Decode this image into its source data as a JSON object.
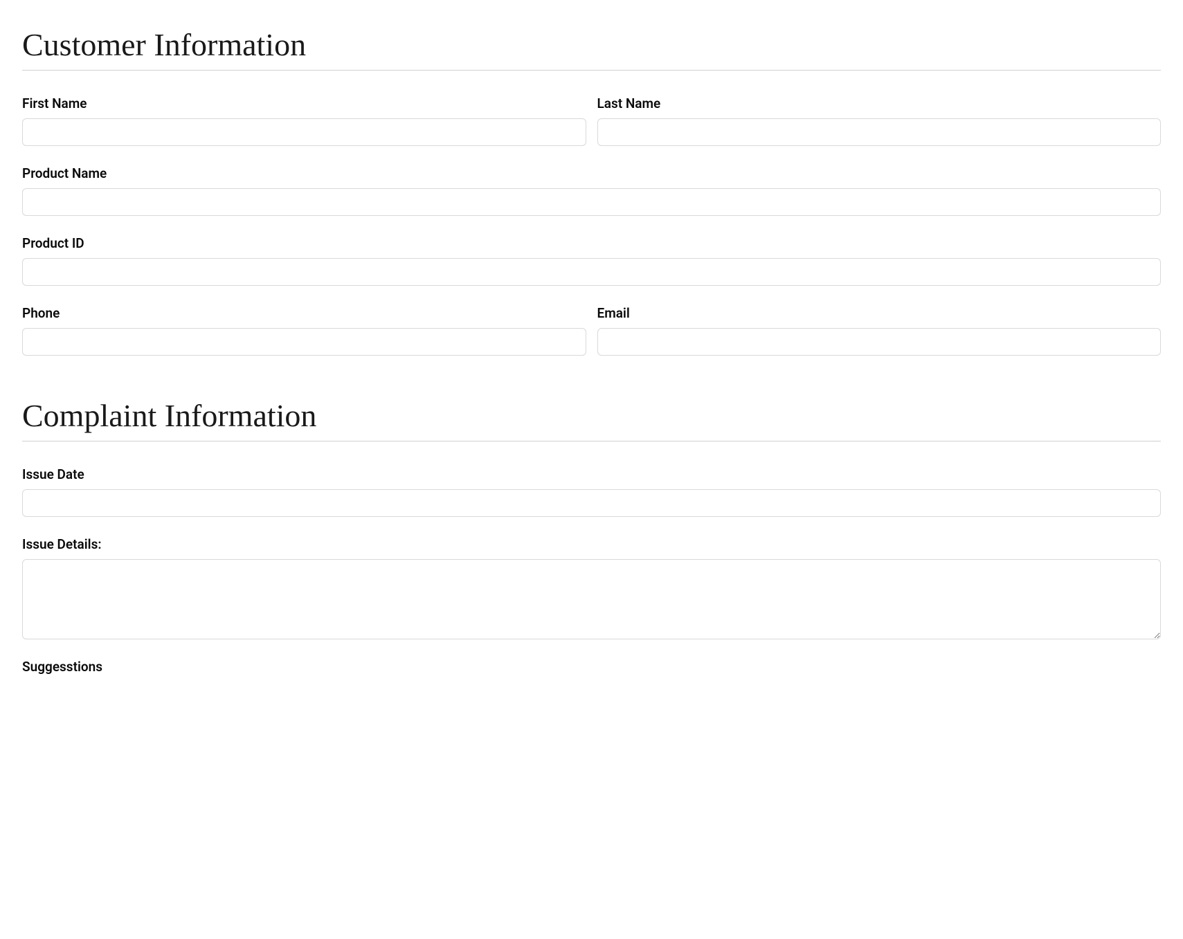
{
  "sections": {
    "customer": {
      "title": "Customer Information",
      "fields": {
        "first_name": {
          "label": "First Name",
          "value": ""
        },
        "last_name": {
          "label": "Last Name",
          "value": ""
        },
        "product_name": {
          "label": "Product Name",
          "value": ""
        },
        "product_id": {
          "label": "Product ID",
          "value": ""
        },
        "phone": {
          "label": "Phone",
          "value": ""
        },
        "email": {
          "label": "Email",
          "value": ""
        }
      }
    },
    "complaint": {
      "title": "Complaint Information",
      "fields": {
        "issue_date": {
          "label": "Issue Date",
          "value": ""
        },
        "issue_details": {
          "label": "Issue Details:",
          "value": ""
        },
        "suggestions": {
          "label": "Suggesstions",
          "value": ""
        }
      }
    }
  }
}
